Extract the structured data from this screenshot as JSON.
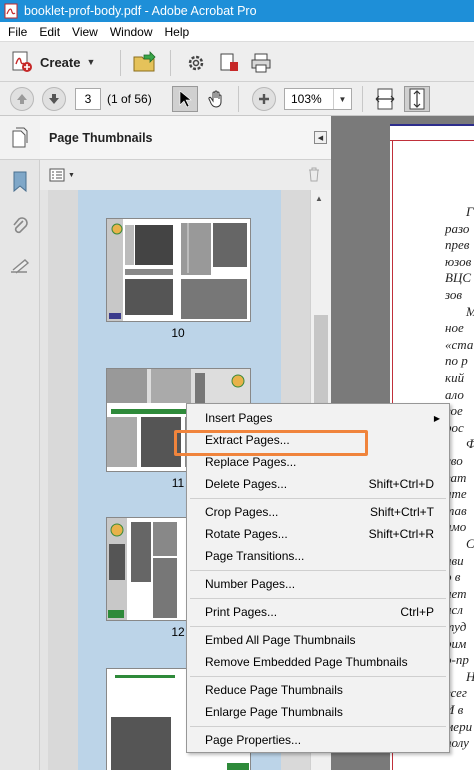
{
  "window": {
    "title": "booklet-prof-body.pdf - Adobe Acrobat Pro"
  },
  "menu": [
    "File",
    "Edit",
    "View",
    "Window",
    "Help"
  ],
  "toolbar": {
    "create_label": "Create"
  },
  "navigation": {
    "page_value": "3",
    "page_of": "(1 of 56)",
    "zoom": "103%"
  },
  "panel": {
    "title": "Page Thumbnails"
  },
  "thumbnails": [
    {
      "page": "10"
    },
    {
      "page": "11"
    },
    {
      "page": "12"
    }
  ],
  "document_lines": [
    "Г",
    "разо",
    "прев",
    "юзов",
    "ВЦС",
    "зов",
    "М",
    "ное",
    "«ста",
    "по р",
    "кий",
    "ало",
    "вое",
    "рос",
    "Ф",
    "сво",
    "ват",
    "ате",
    "тав",
    "амо",
    "С",
    "ави",
    "о в",
    "иет",
    "исл",
    "туд",
    "рим",
    "о-пр",
    "Н",
    "всег",
    "И в",
    "мери",
    "полу"
  ],
  "context_menu": {
    "items": [
      {
        "label": "Insert Pages",
        "shortcut": "",
        "submenu": true
      },
      {
        "label": "Extract Pages...",
        "shortcut": ""
      },
      {
        "label": "Replace Pages...",
        "shortcut": ""
      },
      {
        "label": "Delete Pages...",
        "shortcut": "Shift+Ctrl+D"
      },
      {
        "label": "Crop Pages...",
        "shortcut": "Shift+Ctrl+T"
      },
      {
        "label": "Rotate Pages...",
        "shortcut": "Shift+Ctrl+R"
      },
      {
        "label": "Page Transitions...",
        "shortcut": ""
      },
      {
        "label": "Number Pages...",
        "shortcut": ""
      },
      {
        "label": "Print Pages...",
        "shortcut": "Ctrl+P"
      },
      {
        "label": "Embed All Page Thumbnails",
        "shortcut": ""
      },
      {
        "label": "Remove Embedded Page Thumbnails",
        "shortcut": ""
      },
      {
        "label": "Reduce Page Thumbnails",
        "shortcut": ""
      },
      {
        "label": "Enlarge Page Thumbnails",
        "shortcut": ""
      },
      {
        "label": "Page Properties...",
        "shortcut": ""
      }
    ],
    "highlighted": "Extract Pages..."
  },
  "colors": {
    "titlebar": "#1e8fd8",
    "highlight": "#f0843c",
    "thumb_column": "#bcd4e8"
  }
}
